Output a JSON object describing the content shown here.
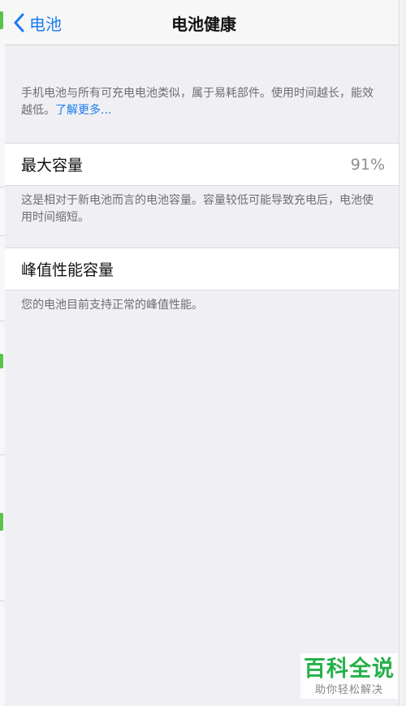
{
  "nav": {
    "back_label": "电池",
    "title": "电池健康"
  },
  "intro": {
    "text": "手机电池与所有可充电电池类似，属于易耗部件。使用时间越长，能效越低。",
    "link": "了解更多..."
  },
  "max_capacity": {
    "label": "最大容量",
    "value": "91%",
    "note": "这是相对于新电池而言的电池容量。容量较低可能导致充电后，电池使用时间缩短。"
  },
  "peak_performance": {
    "label": "峰值性能容量",
    "note": "您的电池目前支持正常的峰值性能。"
  },
  "watermark": {
    "main": "百科全说",
    "sub": "助你轻松解决"
  },
  "colors": {
    "accent": "#1b7cf2",
    "background": "#efeff4",
    "watermark": "#26b04a"
  }
}
